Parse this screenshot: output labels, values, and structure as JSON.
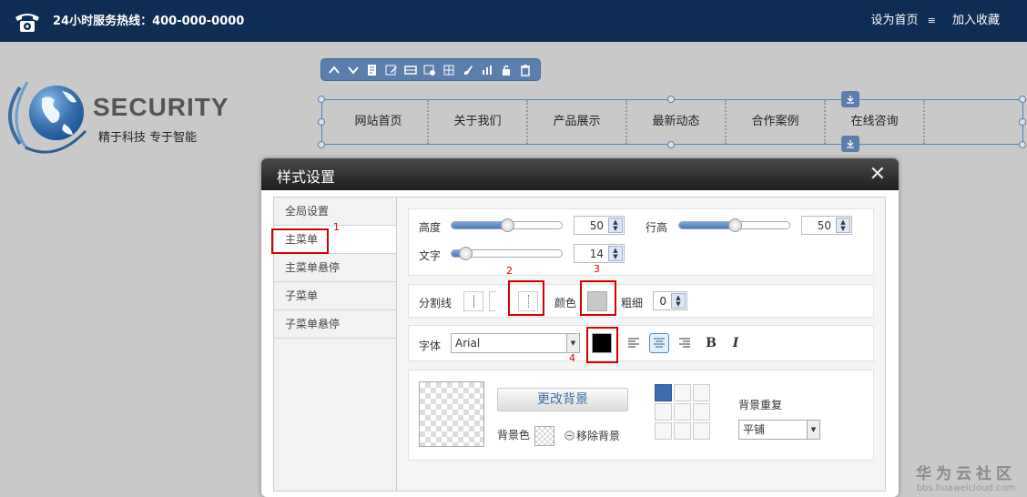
{
  "topbar": {
    "hotline": "24小时服务热线：400-000-0000",
    "set_home": "设为首页",
    "separator": "≡",
    "add_favorite": "加入收藏"
  },
  "logo": {
    "title": "SECURITY",
    "slogan": "精于科技  专于智能"
  },
  "toolbar": {
    "icons": [
      "chevron-up-icon",
      "chevron-down-icon",
      "page-edit-icon",
      "pencil-icon",
      "menu-bar-icon",
      "settings-icon",
      "grid-icon",
      "brush-icon",
      "chart-icon",
      "lock-icon",
      "trash-icon"
    ]
  },
  "nav": {
    "items": [
      "网站首页",
      "关于我们",
      "产品展示",
      "最新动态",
      "合作案例",
      "在线咨询"
    ]
  },
  "dialog": {
    "title": "样式设置",
    "close": "✕",
    "sidebar": [
      {
        "label": "全局设置"
      },
      {
        "label": "主菜单"
      },
      {
        "label": "主菜单悬停"
      },
      {
        "label": "子菜单"
      },
      {
        "label": "子菜单悬停"
      }
    ],
    "active_sidebar_index": 1,
    "size": {
      "height_label": "高度",
      "height_value": "50",
      "line_height_label": "行高",
      "line_height_value": "50",
      "text_label": "文字",
      "text_value": "14"
    },
    "divider": {
      "label": "分割线",
      "color_label": "颜色",
      "color_value": "#c8c8c8",
      "thickness_label": "粗细",
      "thickness_value": "0"
    },
    "font": {
      "label": "字体",
      "family_value": "Arial",
      "color_value": "#000000",
      "bold": "B",
      "italic": "I"
    },
    "background": {
      "change_button": "更改背景",
      "bg_color_label": "背景色",
      "remove_label": "移除背景",
      "repeat_label": "背景重复",
      "repeat_value": "平铺"
    }
  },
  "annotations": {
    "n1": "1",
    "n2": "2",
    "n3": "3",
    "n4": "4"
  },
  "watermark": {
    "line1": "华为云社区",
    "line2": "bbs.huaweicloud.com"
  },
  "colors": {
    "topbar": "#0d2d52",
    "accent": "#4f84c4",
    "highlight": "#d40000"
  }
}
